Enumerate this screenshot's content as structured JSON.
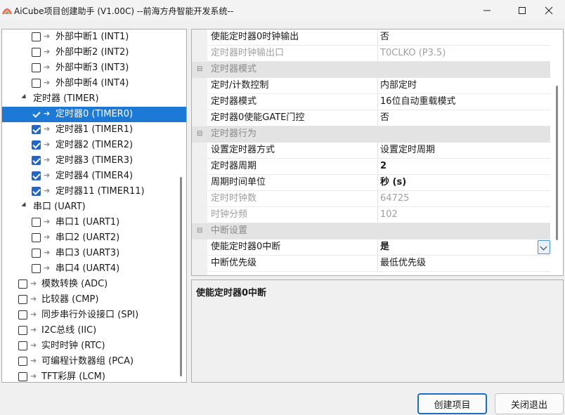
{
  "window": {
    "title": "AiCube项目创建助手 (V1.00C) --前海方舟智能开发系统--"
  },
  "tree": {
    "items": [
      {
        "label": "外部中断1 (INT1)",
        "checked": false
      },
      {
        "label": "外部中断2 (INT2)",
        "checked": false
      },
      {
        "label": "外部中断3 (INT3)",
        "checked": false
      },
      {
        "label": "外部中断4 (INT4)",
        "checked": false
      },
      {
        "label": "定时器 (TIMER)",
        "group": true
      },
      {
        "label": "定时器0 (TIMER0)",
        "checked": true,
        "selected": true
      },
      {
        "label": "定时器1 (TIMER1)",
        "checked": true
      },
      {
        "label": "定时器2 (TIMER2)",
        "checked": true
      },
      {
        "label": "定时器3 (TIMER3)",
        "checked": true
      },
      {
        "label": "定时器4 (TIMER4)",
        "checked": true
      },
      {
        "label": "定时器11 (TIMER11)",
        "checked": true
      },
      {
        "label": "串口 (UART)",
        "group": true
      },
      {
        "label": "串口1 (UART1)",
        "checked": false
      },
      {
        "label": "串口2 (UART2)",
        "checked": false
      },
      {
        "label": "串口3 (UART3)",
        "checked": false
      },
      {
        "label": "串口4 (UART4)",
        "checked": false
      },
      {
        "label": "模数转换 (ADC)",
        "checked": false
      },
      {
        "label": "比较器 (CMP)",
        "checked": false
      },
      {
        "label": "同步串行外设接口 (SPI)",
        "checked": false
      },
      {
        "label": "I2C总线 (IIC)",
        "checked": false
      },
      {
        "label": "实时时钟 (RTC)",
        "checked": false
      },
      {
        "label": "可编程计数器组 (PCA)",
        "checked": false
      },
      {
        "label": "TFT彩屏 (LCM)",
        "checked": false
      }
    ]
  },
  "grid": {
    "rows": [
      {
        "name": "使能定时器0时钟输出",
        "value": "否"
      },
      {
        "name": "定时器时钟输出口",
        "value": "T0CLKO (P3.5)",
        "disabled": true
      },
      {
        "category": "定时器模式"
      },
      {
        "name": "定时/计数控制",
        "value": "内部定时"
      },
      {
        "name": "定时器模式",
        "value": "16位自动重载模式"
      },
      {
        "name": "定时器0使能GATE门控",
        "value": "否"
      },
      {
        "category": "定时器行为"
      },
      {
        "name": "设置定时器方式",
        "value": "设置定时周期"
      },
      {
        "name": "定时器周期",
        "value": "2",
        "bold": true
      },
      {
        "name": "周期时间单位",
        "value": "秒 (s)",
        "bold": true
      },
      {
        "name": "定时时钟数",
        "value": "64725",
        "disabled": true
      },
      {
        "name": "时钟分频",
        "value": "102",
        "disabled": true
      },
      {
        "category": "中断设置"
      },
      {
        "name": "使能定时器0中断",
        "value": "是",
        "bold": true,
        "dropdown": true
      },
      {
        "name": "中断优先级",
        "value": "最低优先级"
      }
    ]
  },
  "description": {
    "title": "使能定时器0中断"
  },
  "buttons": {
    "create": "创建项目",
    "close": "关闭退出"
  }
}
